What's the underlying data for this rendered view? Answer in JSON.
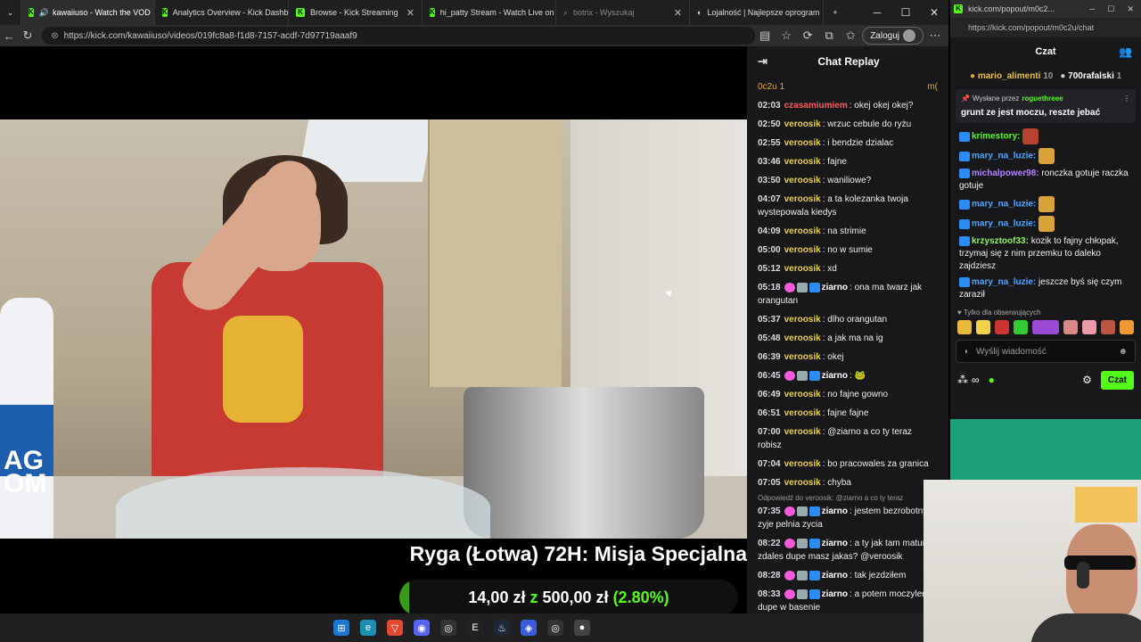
{
  "browser": {
    "tabs": [
      {
        "label": "kawaiiuso - Watch the VOD",
        "active": true
      },
      {
        "label": "Analytics Overview - Kick Dashb"
      },
      {
        "label": "Browse - Kick Streaming"
      },
      {
        "label": "hi_patty Stream - Watch Live on"
      },
      {
        "label": "botrix - Wyszukaj"
      },
      {
        "label": "Lojalność | Najlepsze oprogram"
      }
    ],
    "new_tab": "+",
    "url": "https://kick.com/kawaiiuso/videos/019fc8a8-f1d8-7157-acdf-7d97719aaaf9",
    "login_label": "Zaloguj"
  },
  "video": {
    "title": "Ryga (Łotwa) 72H: Misja Specjalna",
    "donation": {
      "current": "14,00 zł",
      "joiner": "z",
      "goal": "500,00 zł",
      "percent_label": "(2.80%)",
      "fraction": 0.028
    },
    "bottle_text": "AG\nOM"
  },
  "chat_replay": {
    "title": "Chat Replay",
    "leader_left": "0c2u 1",
    "leader_right": "m(",
    "messages": [
      {
        "time": "02:03",
        "user": "czasamiumiem",
        "ucls": "u-czas",
        "text": "okej okej okej?"
      },
      {
        "time": "02:50",
        "user": "veroosik",
        "ucls": "u-veroosik",
        "text": "wrzuc cebule do ryżu"
      },
      {
        "time": "02:55",
        "user": "veroosik",
        "ucls": "u-veroosik",
        "text": "i bendzie dzialac"
      },
      {
        "time": "03:46",
        "user": "veroosik",
        "ucls": "u-veroosik",
        "text": "fajne"
      },
      {
        "time": "03:50",
        "user": "veroosik",
        "ucls": "u-veroosik",
        "text": "waniliowe?"
      },
      {
        "time": "04:07",
        "user": "veroosik",
        "ucls": "u-veroosik",
        "text": "a ta kolezanka twoja wystepowala kiedys"
      },
      {
        "time": "04:09",
        "user": "veroosik",
        "ucls": "u-veroosik",
        "text": "na strimie"
      },
      {
        "time": "05:00",
        "user": "veroosik",
        "ucls": "u-veroosik",
        "text": "no w sumie"
      },
      {
        "time": "05:12",
        "user": "veroosik",
        "ucls": "u-veroosik",
        "text": "xd"
      },
      {
        "time": "05:18",
        "user": "ziarno",
        "ucls": "u-ziarno",
        "badges": true,
        "text": "ona ma twarz jak orangutan"
      },
      {
        "time": "05:37",
        "user": "veroosik",
        "ucls": "u-veroosik",
        "text": "dlho orangutan"
      },
      {
        "time": "05:48",
        "user": "veroosik",
        "ucls": "u-veroosik",
        "text": "a jak ma na ig"
      },
      {
        "time": "06:39",
        "user": "veroosik",
        "ucls": "u-veroosik",
        "text": "okej"
      },
      {
        "time": "06:45",
        "user": "ziarno",
        "ucls": "u-ziarno",
        "badges": true,
        "text": "🐸"
      },
      {
        "time": "06:49",
        "user": "veroosik",
        "ucls": "u-veroosik",
        "text": "no fajne gowno"
      },
      {
        "time": "06:51",
        "user": "veroosik",
        "ucls": "u-veroosik",
        "text": "fajne fajne"
      },
      {
        "time": "07:00",
        "user": "veroosik",
        "ucls": "u-veroosik",
        "text": "@ziarno a co ty teraz robisz"
      },
      {
        "time": "07:04",
        "user": "veroosik",
        "ucls": "u-veroosik",
        "text": "bo pracowales za granica"
      },
      {
        "time": "07:05",
        "user": "veroosik",
        "ucls": "u-veroosik",
        "text": "chyba"
      },
      {
        "reply": "Odpowiedź do veroosik: @ziarno a co ty teraz",
        "time": "07:35",
        "user": "ziarno",
        "ucls": "u-ziarno",
        "badges": true,
        "text": "jestem bezrobotny zyje pelnia zycia"
      },
      {
        "time": "08:22",
        "user": "ziarno",
        "ucls": "u-ziarno",
        "badges": true,
        "text": "a ty jak tam matur zdales dupe masz jakas? @veroosik"
      },
      {
        "time": "08:28",
        "user": "ziarno",
        "ucls": "u-ziarno",
        "badges": true,
        "text": "tak jezdziłem"
      },
      {
        "time": "08:33",
        "user": "ziarno",
        "ucls": "u-ziarno",
        "badges": true,
        "text": "a potem moczyler dupe w basenie"
      }
    ]
  },
  "popout": {
    "window_title": "kick.com/popout/m0c2...",
    "url": "https://kick.com/popout/m0c2u/chat",
    "header": "Czat",
    "leaders": [
      {
        "name": "mario_alimenti",
        "count": "10"
      },
      {
        "name": "700rafalski",
        "count": "1"
      }
    ],
    "pinned": {
      "prefix": "Wysłane przez",
      "by": "roguethreee",
      "message": "grunt ze jest moczu, reszte jebać"
    },
    "messages": [
      {
        "user": "krimestory:",
        "ucls": "pu-green",
        "text": "",
        "emote": "red"
      },
      {
        "user": "mary_na_luzie:",
        "ucls": "pu-blue",
        "text": "",
        "emote": "gold"
      },
      {
        "user": "michalpower98:",
        "ucls": "pu-purple",
        "text": "ronczka gotuje raczka gotuje"
      },
      {
        "user": "mary_na_luzie:",
        "ucls": "pu-blue",
        "text": "",
        "emote": "gold"
      },
      {
        "user": "mary_na_luzie:",
        "ucls": "pu-blue",
        "text": "",
        "emote": "gold"
      },
      {
        "user": "krzysztoof33:",
        "ucls": "pu-lime",
        "text": "kozik to fajny chłopak, trzymaj się z nim przemku to daleko zajdziesz"
      },
      {
        "user": "mary_na_luzie:",
        "ucls": "pu-blue",
        "text": "jeszcze byś się czym zaraził"
      }
    ],
    "followers_only": "Tylko dla obserwujących",
    "input_placeholder": "Wyślij wiadomość",
    "send_label": "Czat",
    "footer_counter": "∞"
  }
}
